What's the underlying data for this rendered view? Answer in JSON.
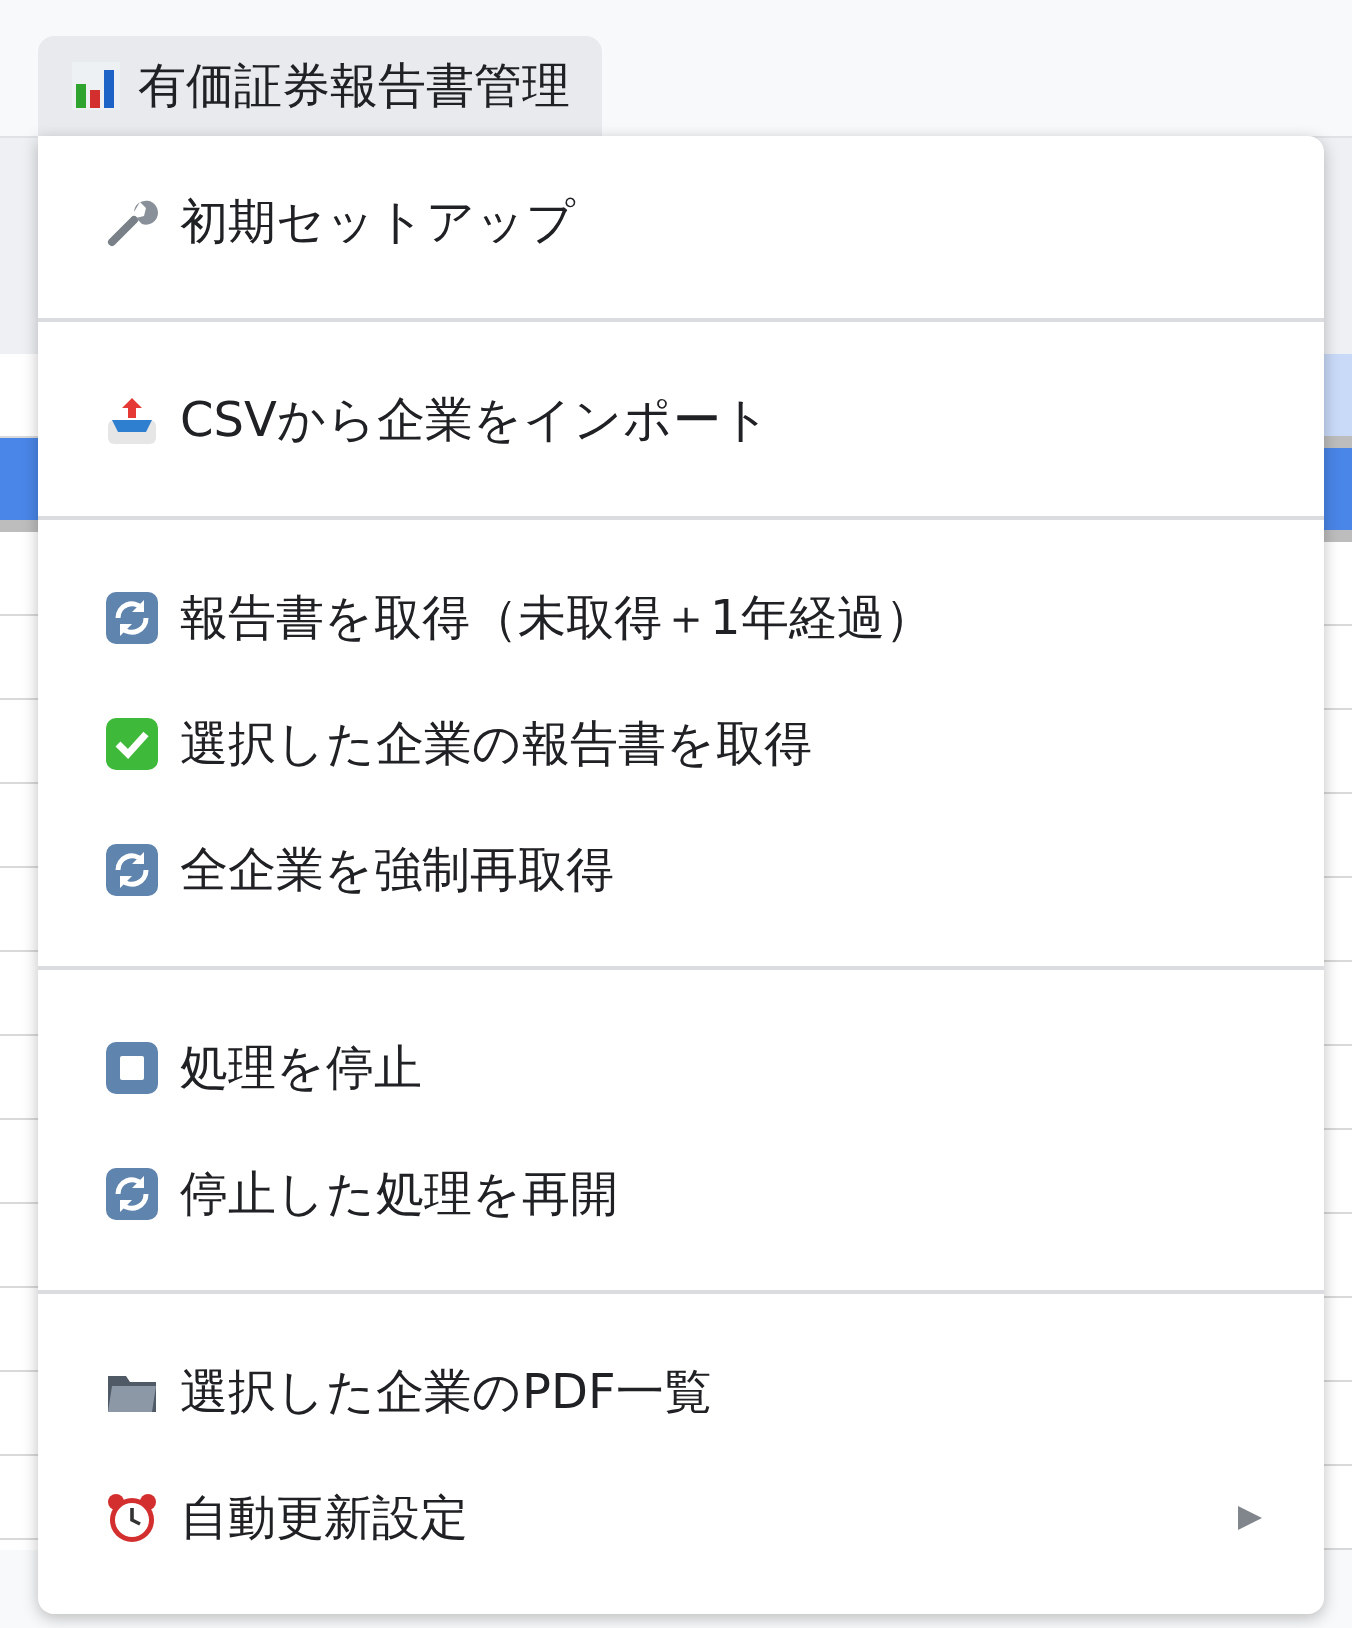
{
  "menu_bar": {
    "menu": {
      "label": "有価証券報告書管理",
      "open": true
    }
  },
  "dropdown": {
    "groups": [
      {
        "items": [
          {
            "label": "初期セットアップ",
            "kind": "wrench",
            "submenu": false
          }
        ]
      },
      {
        "items": [
          {
            "label": "CSVから企業をインポート",
            "kind": "inbox",
            "submenu": false
          }
        ]
      },
      {
        "items": [
          {
            "label": "報告書を取得（未取得＋1年経過）",
            "kind": "refresh",
            "submenu": false
          },
          {
            "label": "選択した企業の報告書を取得",
            "kind": "check",
            "submenu": false
          },
          {
            "label": "全企業を強制再取得",
            "kind": "refresh",
            "submenu": false
          }
        ]
      },
      {
        "items": [
          {
            "label": "処理を停止",
            "kind": "stop",
            "submenu": false
          },
          {
            "label": "停止した処理を再開",
            "kind": "refresh",
            "submenu": false
          }
        ]
      },
      {
        "items": [
          {
            "label": "選択した企業のPDF一覧",
            "kind": "folder",
            "submenu": false
          },
          {
            "label": "自動更新設定",
            "kind": "clock",
            "submenu": true
          }
        ]
      }
    ]
  }
}
